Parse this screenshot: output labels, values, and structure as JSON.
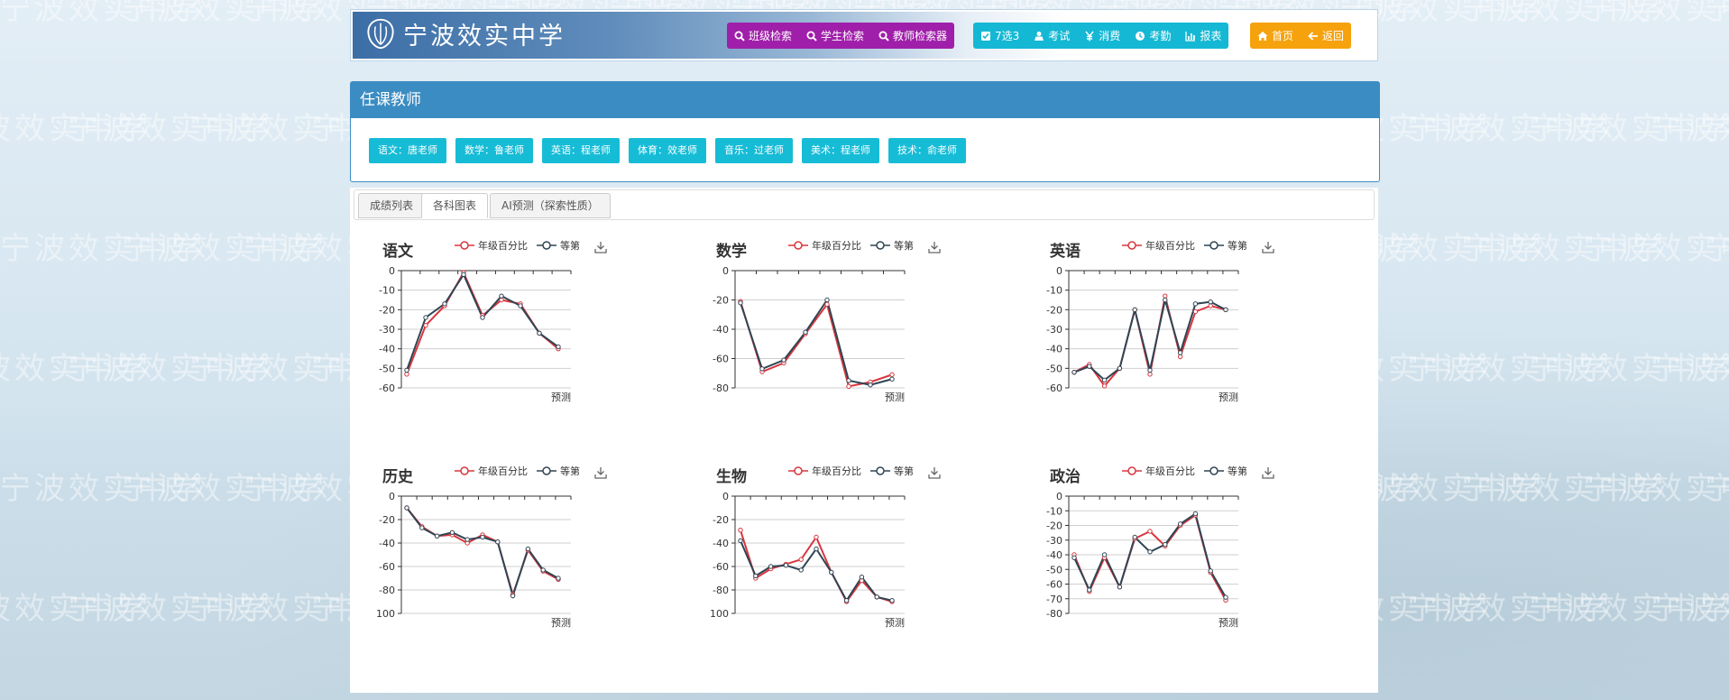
{
  "header": {
    "logo_text": "宁波效实中学",
    "nav_purple": [
      {
        "label": "班级检索",
        "icon": "search-icon"
      },
      {
        "label": "学生检索",
        "icon": "search-icon"
      },
      {
        "label": "教师检索器",
        "icon": "search-icon"
      }
    ],
    "nav_cyan": [
      {
        "label": "7选3",
        "icon": "checkbox-icon"
      },
      {
        "label": "考试",
        "icon": "exam-icon"
      },
      {
        "label": "消费",
        "icon": "yen-icon"
      },
      {
        "label": "考勤",
        "icon": "clock-icon"
      },
      {
        "label": "报表",
        "icon": "bar-chart-icon"
      }
    ],
    "nav_orange": [
      {
        "label": "首页",
        "icon": "home-icon"
      },
      {
        "label": "返回",
        "icon": "arrow-left-icon"
      }
    ]
  },
  "teachers": {
    "title": "任课教师",
    "tags": [
      "语文：唐老师",
      "数学：鲁老师",
      "英语：程老师",
      "体育：效老师",
      "音乐：过老师",
      "美术：程老师",
      "技术：俞老师"
    ]
  },
  "tabs": [
    {
      "label": "成绩列表",
      "active": false
    },
    {
      "label": "各科图表",
      "active": true
    },
    {
      "label": "AI预测（探索性质）",
      "active": false
    }
  ],
  "colors": {
    "percent": "#d9363e",
    "rank": "#2f4554",
    "purple": "#a01faa",
    "cyan": "#14b8d4",
    "orange": "#f6a20d",
    "panel": "#3b8cc2"
  },
  "chart_data": [
    {
      "type": "line",
      "title": "语文",
      "ylim": [
        -60,
        0
      ],
      "yticks": [
        0,
        -10,
        -20,
        -30,
        -40,
        -50,
        -60
      ],
      "xlabel_end": "预测",
      "series": [
        {
          "name": "年级百分比",
          "values": [
            -53,
            -28,
            -18,
            -1,
            -23,
            -15,
            -17,
            -32,
            -40
          ]
        },
        {
          "name": "等第",
          "values": [
            -51,
            -24,
            -17,
            -2,
            -24,
            -13,
            -18,
            -32,
            -39
          ]
        }
      ]
    },
    {
      "type": "line",
      "title": "数学",
      "ylim": [
        -80,
        0
      ],
      "yticks": [
        0,
        -20,
        -40,
        -60,
        -80
      ],
      "xlabel_end": "预测",
      "series": [
        {
          "name": "年级百分比",
          "values": [
            -21,
            -69,
            -63,
            -43,
            -23,
            -79,
            -76,
            -71
          ]
        },
        {
          "name": "等第",
          "values": [
            -22,
            -67,
            -61,
            -42,
            -20,
            -75,
            -78,
            -74
          ]
        }
      ]
    },
    {
      "type": "line",
      "title": "英语",
      "ylim": [
        -60,
        0
      ],
      "yticks": [
        0,
        -10,
        -20,
        -30,
        -40,
        -50,
        -60
      ],
      "xlabel_end": "预测",
      "series": [
        {
          "name": "年级百分比",
          "values": [
            -52,
            -48,
            -59,
            -50,
            -20,
            -53,
            -13,
            -44,
            -21,
            -18,
            -20
          ]
        },
        {
          "name": "等第",
          "values": [
            -52,
            -49,
            -56,
            -50,
            -20,
            -51,
            -15,
            -42,
            -17,
            -16,
            -20
          ]
        }
      ]
    },
    {
      "type": "line",
      "title": "历史",
      "ylim": [
        -100,
        0
      ],
      "yticks": [
        0,
        -20,
        -40,
        -60,
        -80,
        -100
      ],
      "ytick_labels": [
        "0",
        "-20",
        "-40",
        "-60",
        "-80",
        "100"
      ],
      "xlabel_end": "预测",
      "series": [
        {
          "name": "年级百分比",
          "values": [
            -10,
            -26,
            -34,
            -33,
            -40,
            -33,
            -39,
            -84,
            -46,
            -64,
            -71
          ]
        },
        {
          "name": "等第",
          "values": [
            -10,
            -27,
            -34,
            -31,
            -37,
            -35,
            -39,
            -85,
            -45,
            -63,
            -70
          ]
        }
      ]
    },
    {
      "type": "line",
      "title": "生物",
      "ylim": [
        -100,
        0
      ],
      "yticks": [
        0,
        -20,
        -40,
        -60,
        -80,
        -100
      ],
      "ytick_labels": [
        "0",
        "-20",
        "-40",
        "-60",
        "-80",
        "100"
      ],
      "xlabel_end": "预测",
      "series": [
        {
          "name": "年级百分比",
          "values": [
            -29,
            -70,
            -62,
            -58,
            -54,
            -35,
            -65,
            -90,
            -72,
            -86,
            -90
          ]
        },
        {
          "name": "等第",
          "values": [
            -38,
            -68,
            -60,
            -59,
            -63,
            -45,
            -65,
            -89,
            -69,
            -86,
            -89
          ]
        }
      ]
    },
    {
      "type": "line",
      "title": "政治",
      "ylim": [
        -80,
        0
      ],
      "yticks": [
        0,
        -10,
        -20,
        -30,
        -40,
        -50,
        -60,
        -70,
        -80
      ],
      "xlabel_end": "预测",
      "series": [
        {
          "name": "年级百分比",
          "values": [
            -40,
            -65,
            -42,
            -62,
            -29,
            -24,
            -34,
            -20,
            -13,
            -52,
            -71
          ]
        },
        {
          "name": "等第",
          "values": [
            -42,
            -64,
            -40,
            -62,
            -28,
            -38,
            -33,
            -19,
            -12,
            -51,
            -69
          ]
        }
      ]
    }
  ]
}
